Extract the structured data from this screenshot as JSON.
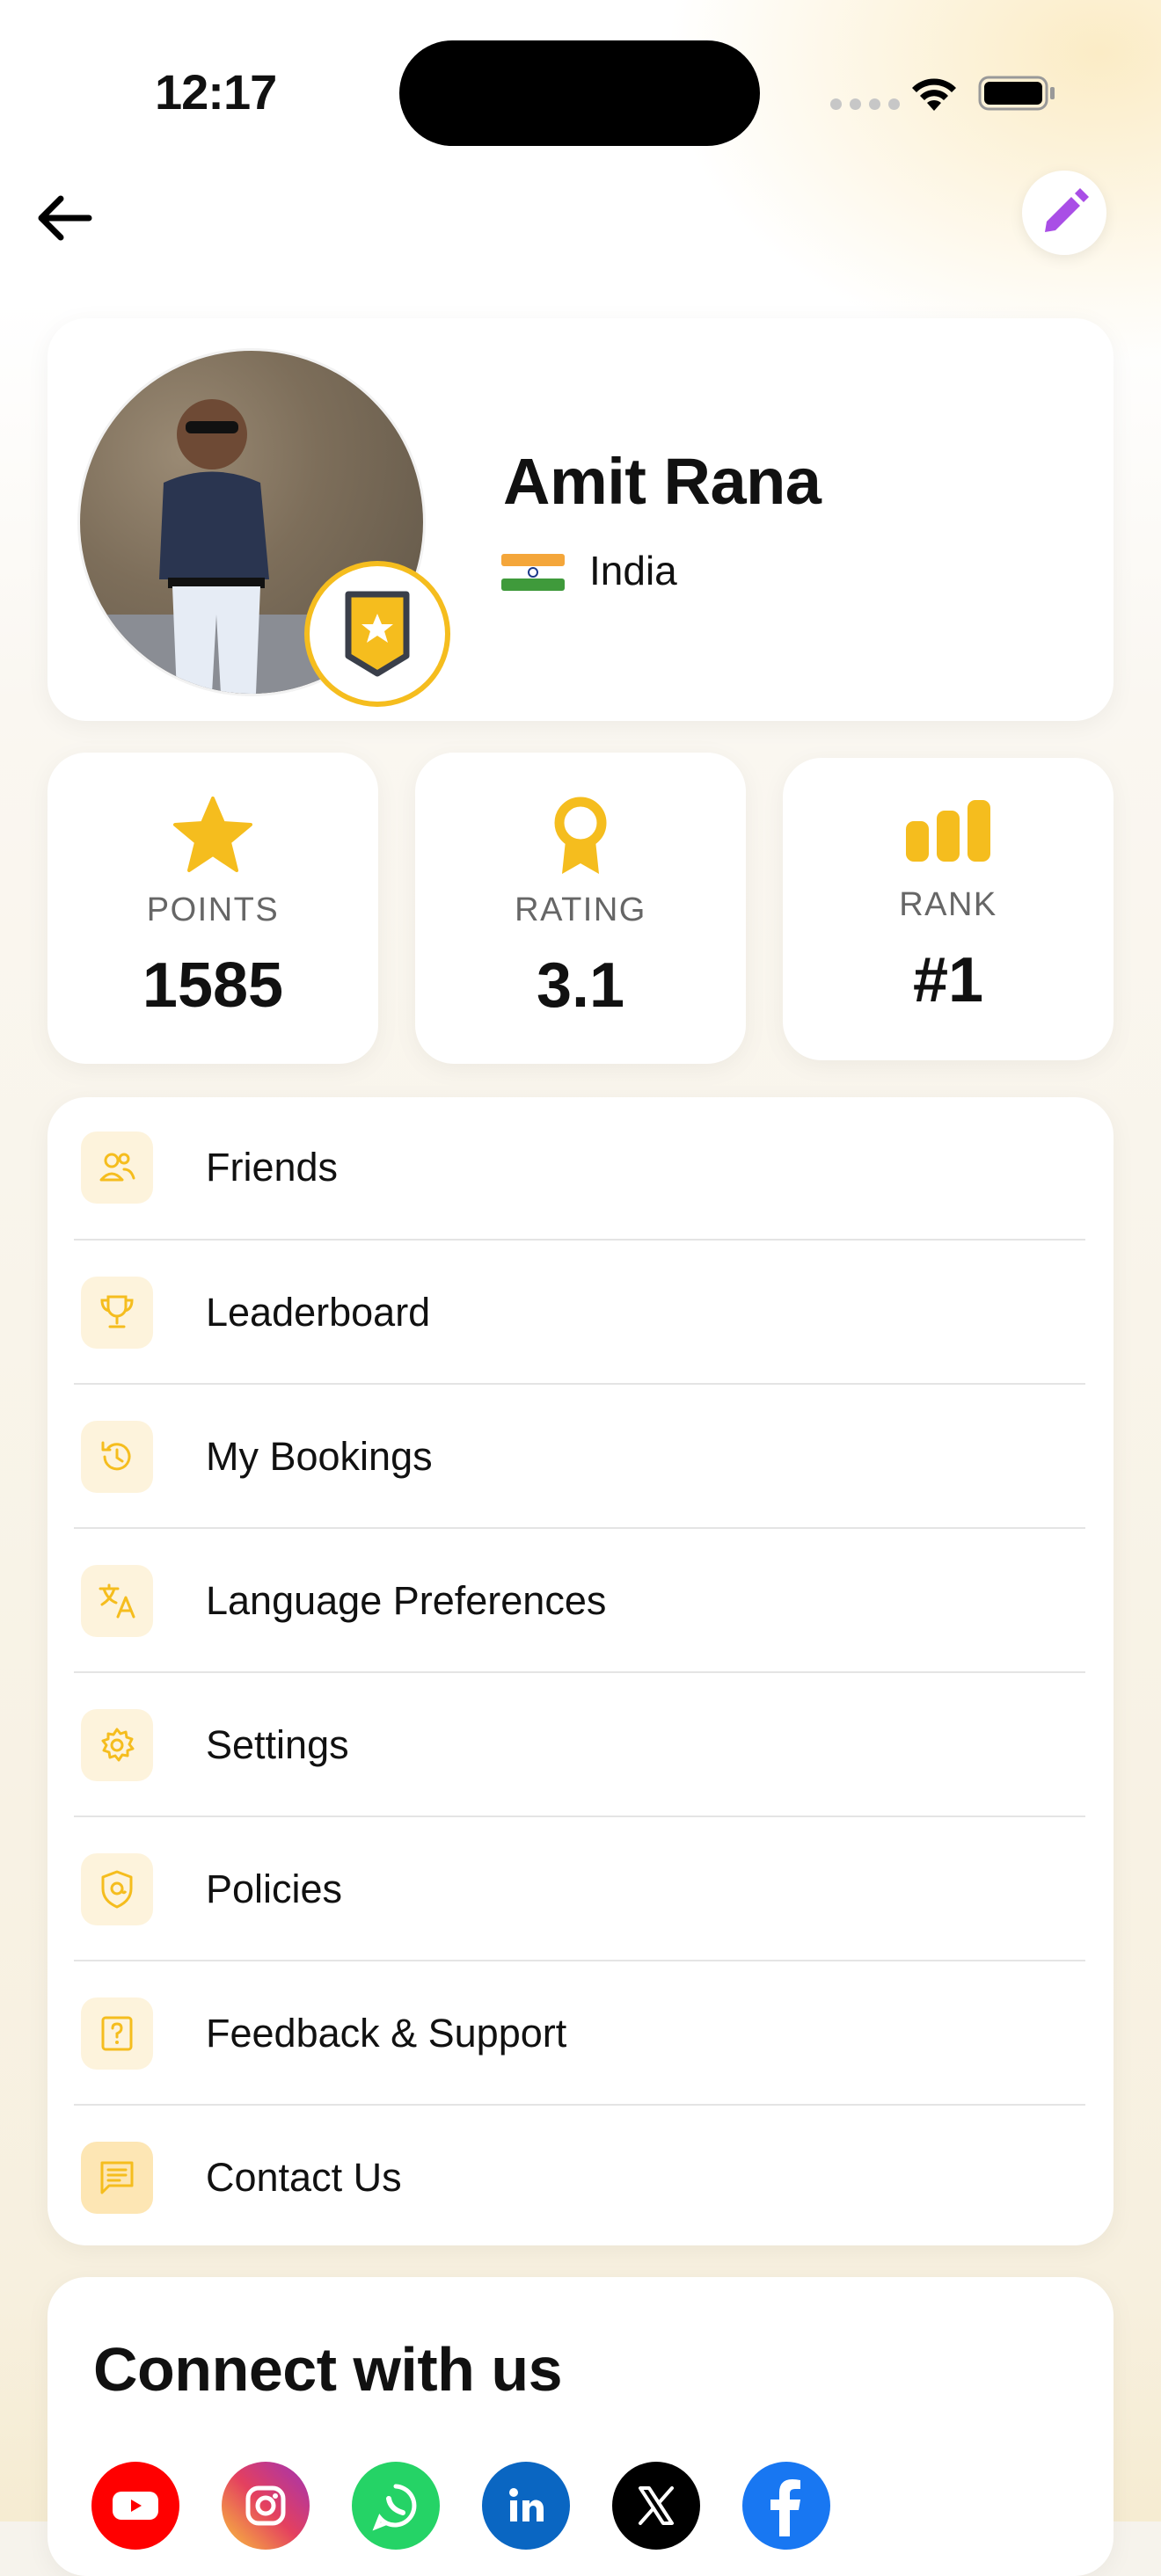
{
  "status_bar": {
    "time": "12:17"
  },
  "profile": {
    "name": "Amit Rana",
    "country": "India"
  },
  "stats": [
    {
      "label": "POINTS",
      "value": "1585",
      "icon": "star-icon"
    },
    {
      "label": "RATING",
      "value": "3.1",
      "icon": "award-ribbon-icon"
    },
    {
      "label": "RANK",
      "value": "#1",
      "icon": "bar-chart-icon"
    }
  ],
  "menu": {
    "items": [
      {
        "label": "Friends",
        "icon": "friends-icon"
      },
      {
        "label": "Leaderboard",
        "icon": "trophy-icon"
      },
      {
        "label": "My Bookings",
        "icon": "history-icon"
      },
      {
        "label": "Language Preferences",
        "icon": "translate-icon"
      },
      {
        "label": "Settings",
        "icon": "gear-icon"
      },
      {
        "label": "Policies",
        "icon": "shield-icon"
      },
      {
        "label": "Feedback & Support",
        "icon": "question-icon"
      },
      {
        "label": "Contact Us",
        "icon": "message-icon"
      }
    ]
  },
  "connect": {
    "title": "Connect with us",
    "socials": [
      "youtube-icon",
      "instagram-icon",
      "whatsapp-icon",
      "linkedin-icon",
      "x-icon",
      "facebook-icon"
    ]
  },
  "colors": {
    "accent": "#f5bd1e",
    "edit": "#a94ee6",
    "icon_bg": "#fdf3dc"
  }
}
